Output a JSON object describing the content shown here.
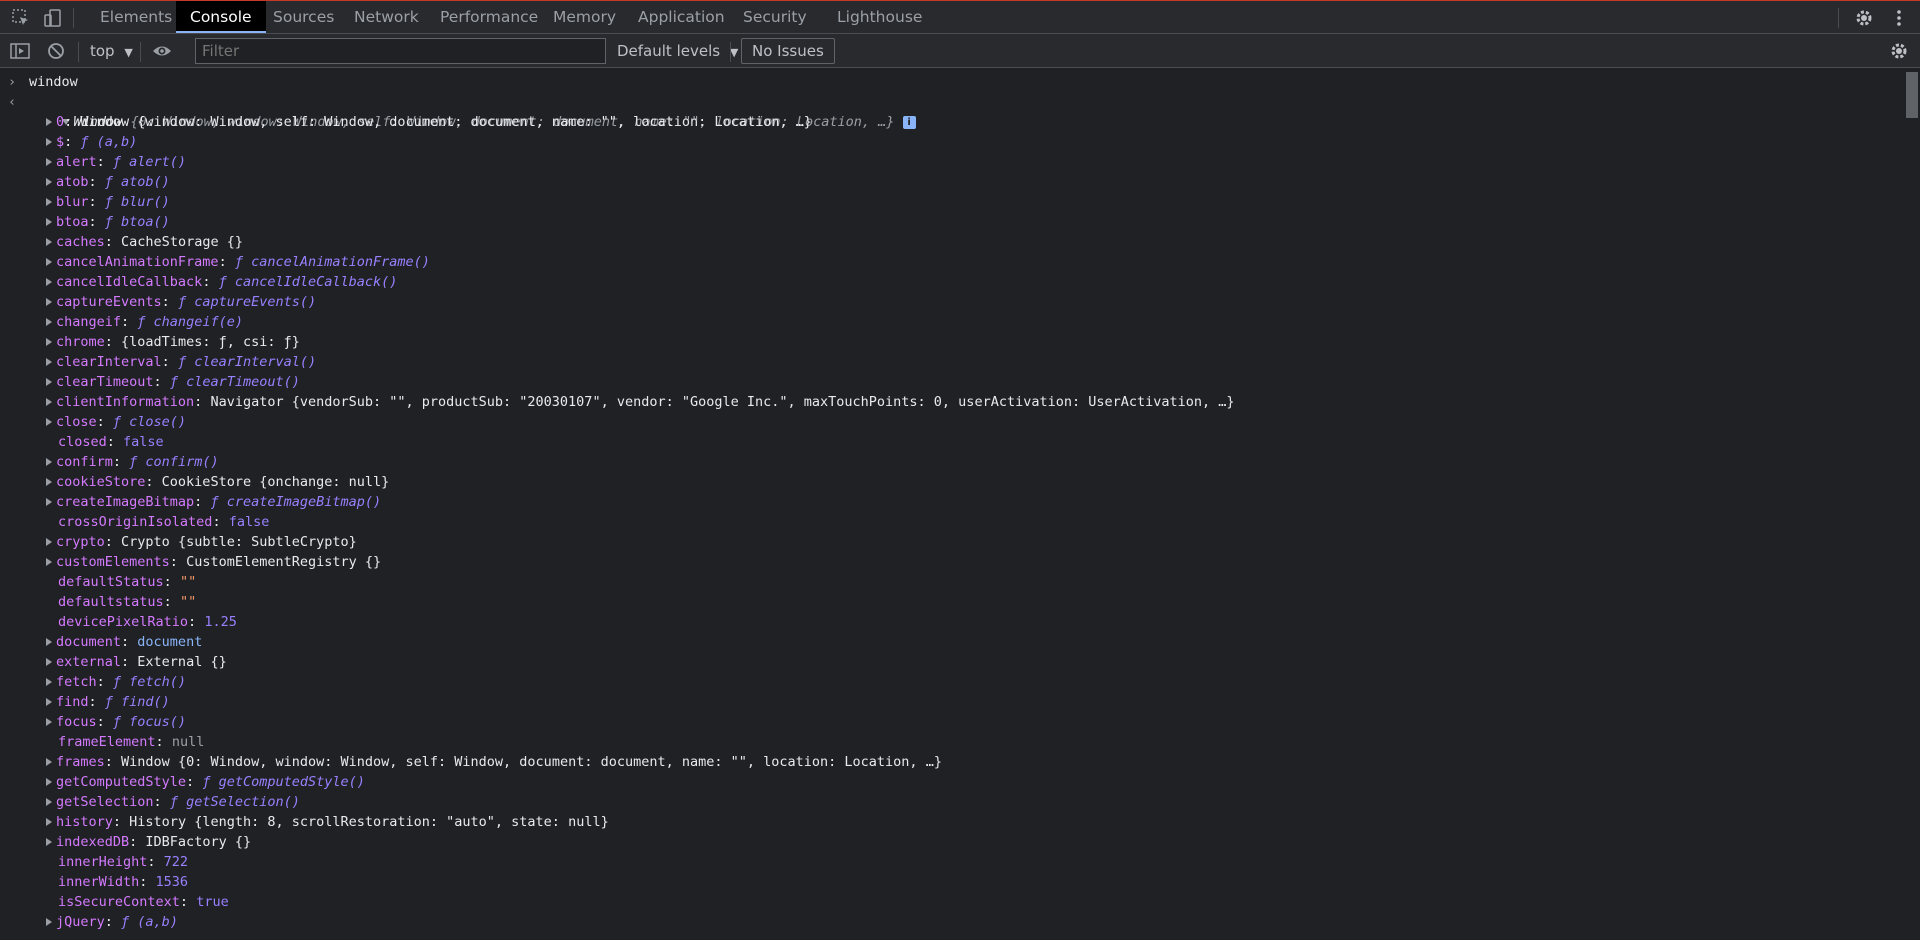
{
  "tabs": [
    "Elements",
    "Console",
    "Sources",
    "Network",
    "Performance",
    "Memory",
    "Application",
    "Security",
    "Lighthouse"
  ],
  "active_tab": "Console",
  "toolbar": {
    "context": "top",
    "filter_placeholder": "Filter",
    "levels": "Default levels",
    "issues": "No Issues"
  },
  "console": {
    "input": "window",
    "output_label": "Window",
    "output_preview": "{0: Window, window: Window, self: Window, document: document, name: \"\", location: Location, …}",
    "props": [
      {
        "key": "0",
        "value": "Window {window: Window, self: Window, document: document, name: \"\", location: Location, …}"
      },
      {
        "key": "$",
        "value": "ƒ (a,b)"
      },
      {
        "key": "alert",
        "value": "ƒ alert()"
      },
      {
        "key": "atob",
        "value": "ƒ atob()"
      },
      {
        "key": "blur",
        "value": "ƒ blur()"
      },
      {
        "key": "btoa",
        "value": "ƒ btoa()"
      },
      {
        "key": "caches",
        "value": "CacheStorage {}"
      },
      {
        "key": "cancelAnimationFrame",
        "value": "ƒ cancelAnimationFrame()"
      },
      {
        "key": "cancelIdleCallback",
        "value": "ƒ cancelIdleCallback()"
      },
      {
        "key": "captureEvents",
        "value": "ƒ captureEvents()"
      },
      {
        "key": "changeif",
        "value": "ƒ changeif(e)"
      },
      {
        "key": "chrome",
        "value": "{loadTimes: ƒ, csi: ƒ}"
      },
      {
        "key": "clearInterval",
        "value": "ƒ clearInterval()"
      },
      {
        "key": "clearTimeout",
        "value": "ƒ clearTimeout()"
      },
      {
        "key": "clientInformation",
        "value": "Navigator {vendorSub: \"\", productSub: \"20030107\", vendor: \"Google Inc.\", maxTouchPoints: 0, userActivation: UserActivation, …}"
      },
      {
        "key": "close",
        "value": "ƒ close()"
      },
      {
        "key": "closed",
        "value": "false"
      },
      {
        "key": "confirm",
        "value": "ƒ confirm()"
      },
      {
        "key": "cookieStore",
        "value": "CookieStore {onchange: null}"
      },
      {
        "key": "createImageBitmap",
        "value": "ƒ createImageBitmap()"
      },
      {
        "key": "crossOriginIsolated",
        "value": "false"
      },
      {
        "key": "crypto",
        "value": "Crypto {subtle: SubtleCrypto}"
      },
      {
        "key": "customElements",
        "value": "CustomElementRegistry {}"
      },
      {
        "key": "defaultStatus",
        "value": "\"\""
      },
      {
        "key": "defaultstatus",
        "value": "\"\""
      },
      {
        "key": "devicePixelRatio",
        "value": "1.25"
      },
      {
        "key": "document",
        "value": "document"
      },
      {
        "key": "external",
        "value": "External {}"
      },
      {
        "key": "fetch",
        "value": "ƒ fetch()"
      },
      {
        "key": "find",
        "value": "ƒ find()"
      },
      {
        "key": "focus",
        "value": "ƒ focus()"
      },
      {
        "key": "frameElement",
        "value": "null"
      },
      {
        "key": "frames",
        "value": "Window {0: Window, window: Window, self: Window, document: document, name: \"\", location: Location, …}"
      },
      {
        "key": "getComputedStyle",
        "value": "ƒ getComputedStyle()"
      },
      {
        "key": "getSelection",
        "value": "ƒ getSelection()"
      },
      {
        "key": "history",
        "value": "History {length: 8, scrollRestoration: \"auto\", state: null}"
      },
      {
        "key": "indexedDB",
        "value": "IDBFactory {}"
      },
      {
        "key": "innerHeight",
        "value": "722"
      },
      {
        "key": "innerWidth",
        "value": "1536"
      },
      {
        "key": "isSecureContext",
        "value": "true"
      },
      {
        "key": "jQuery",
        "value": "ƒ (a,b)"
      }
    ]
  }
}
